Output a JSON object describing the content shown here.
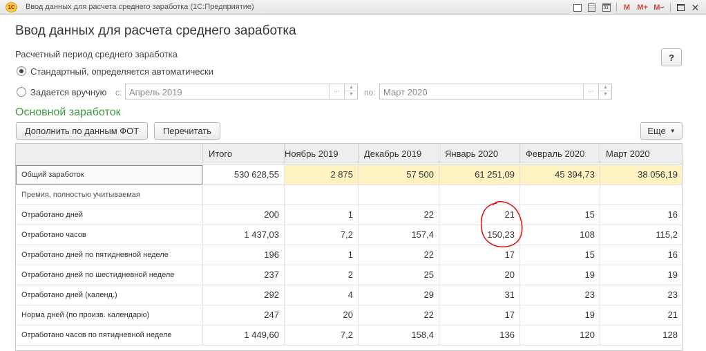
{
  "window": {
    "title": "Ввод данных для расчета среднего заработка  (1С:Предприятие)",
    "logo_text": "1С",
    "toolbar_icons": [
      "print-icon",
      "calculator-icon",
      "calendar-icon",
      "memory-m-icon",
      "memory-plus-icon",
      "memory-minus-icon",
      "restore-window-icon",
      "close-icon"
    ],
    "calendar_digit": "31",
    "m_label": "M",
    "m_plus_label": "M+",
    "m_minus_label": "M−",
    "close_glyph": "✕"
  },
  "form": {
    "title": "Ввод данных для расчета среднего заработка",
    "help_label": "?",
    "period_heading": "Расчетный период среднего заработка",
    "radio_auto_label": "Стандартный, определяется автоматически",
    "radio_manual_label": "Задается вручную",
    "from_label": "с:",
    "from_value": "Апрель 2019",
    "to_label": "по:",
    "to_value": "Март 2020",
    "field_button_glyph": "...",
    "spin_up_glyph": "▲",
    "spin_down_glyph": "▼"
  },
  "earnings": {
    "section_title": "Основной заработок",
    "fill_button_label": "Дополнить по данным ФОТ",
    "recalc_button_label": "Перечитать",
    "more_button_label": "Еще",
    "more_caret": "▼"
  },
  "table": {
    "columns": [
      "",
      "Итого",
      "Ноябрь 2019",
      "Декабрь 2019",
      "Январь 2020",
      "Февраль 2020",
      "Март 2020"
    ],
    "rows": [
      {
        "name": "Общий заработок",
        "values": [
          "530 628,55",
          "2 875",
          "57 500",
          "61 251,09",
          "45 394,73",
          "38 056,19"
        ]
      },
      {
        "name": "Премия, полностью учитываемая",
        "values": [
          "",
          "",
          "",
          "",
          "",
          ""
        ]
      },
      {
        "name": "Отработано дней",
        "values": [
          "200",
          "1",
          "22",
          "21",
          "15",
          "16"
        ]
      },
      {
        "name": "Отработано часов",
        "values": [
          "1 437,03",
          "7,2",
          "157,4",
          "150,23",
          "108",
          "115,2"
        ]
      },
      {
        "name": "Отработано дней по пятидневной неделе",
        "values": [
          "196",
          "1",
          "22",
          "17",
          "15",
          "16"
        ]
      },
      {
        "name": "Отработано дней по шестидневной неделе",
        "values": [
          "237",
          "2",
          "25",
          "20",
          "19",
          "19"
        ]
      },
      {
        "name": "Отработано дней (календ.)",
        "values": [
          "292",
          "4",
          "29",
          "31",
          "23",
          "23"
        ]
      },
      {
        "name": "Норма дней (по произв. календарю)",
        "values": [
          "247",
          "20",
          "22",
          "17",
          "19",
          "21"
        ]
      },
      {
        "name": "Отработано часов по пятидневной неделе",
        "values": [
          "1 449,60",
          "7,2",
          "158,4",
          "136",
          "120",
          "128"
        ]
      }
    ]
  },
  "annotation": {
    "color": "#e01616"
  }
}
